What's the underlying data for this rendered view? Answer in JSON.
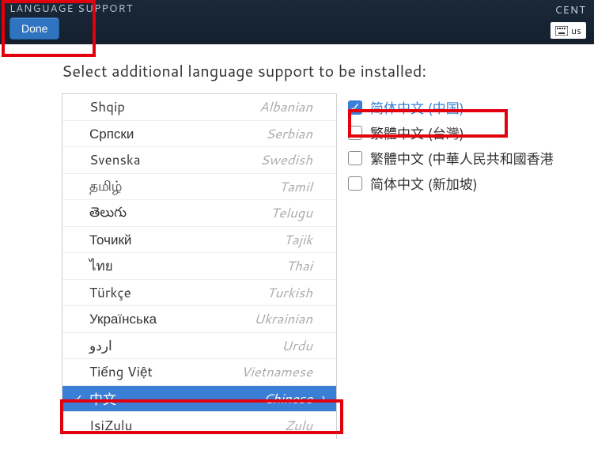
{
  "header": {
    "title": "LANGUAGE SUPPORT",
    "done_label": "Done",
    "right_text": "CENT",
    "kb_label": "us"
  },
  "prompt": "Select additional language support to be installed:",
  "languages": [
    {
      "native": "Shqip",
      "english": "Albanian",
      "selected": false
    },
    {
      "native": "Српски",
      "english": "Serbian",
      "selected": false
    },
    {
      "native": "Svenska",
      "english": "Swedish",
      "selected": false
    },
    {
      "native": "தமிழ்",
      "english": "Tamil",
      "selected": false
    },
    {
      "native": "తెలుగు",
      "english": "Telugu",
      "selected": false
    },
    {
      "native": "Точикй",
      "english": "Tajik",
      "selected": false
    },
    {
      "native": "ไทย",
      "english": "Thai",
      "selected": false
    },
    {
      "native": "Türkçe",
      "english": "Turkish",
      "selected": false
    },
    {
      "native": "Українська",
      "english": "Ukrainian",
      "selected": false
    },
    {
      "native": "اردو",
      "english": "Urdu",
      "selected": false
    },
    {
      "native": "Tiếng Việt",
      "english": "Vietnamese",
      "selected": false
    },
    {
      "native": "中文",
      "english": "Chinese",
      "selected": true
    },
    {
      "native": "IsiZulu",
      "english": "Zulu",
      "selected": false
    }
  ],
  "variants": [
    {
      "label": "简体中文 (中国)",
      "checked": true
    },
    {
      "label": "繁體中文 (台灣)",
      "checked": false
    },
    {
      "label": "繁體中文 (中華人民共和國香港",
      "checked": false
    },
    {
      "label": "简体中文 (新加坡)",
      "checked": false
    }
  ]
}
